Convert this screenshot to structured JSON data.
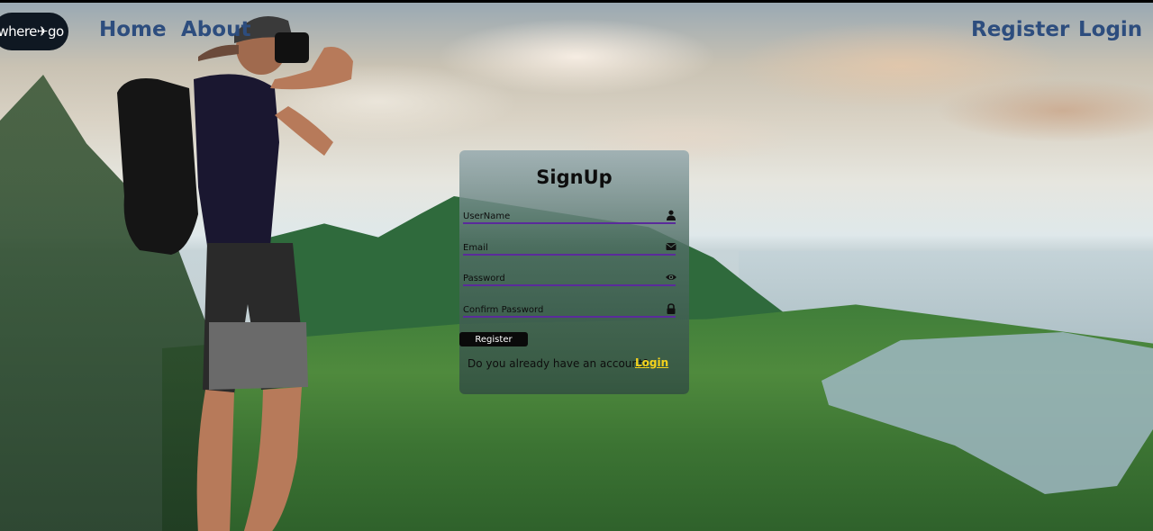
{
  "nav": {
    "logo_text": "where✈go",
    "home": "Home",
    "about": "About",
    "register": "Register",
    "login": "Login"
  },
  "signup": {
    "title": "SignUp",
    "fields": [
      {
        "placeholder": "UserName",
        "icon": "user-icon"
      },
      {
        "placeholder": "Email",
        "icon": "envelope-icon"
      },
      {
        "placeholder": "Password",
        "icon": "eye-icon"
      },
      {
        "placeholder": "Confirm Password",
        "icon": "lock-icon"
      }
    ],
    "register_button": "Register",
    "have_account": "Do you already have an account?",
    "login_link": "Login"
  },
  "colors": {
    "nav_link": "#2d4d7e",
    "field_underline": "#5a2b9b",
    "login_link": "#f5d31c",
    "logo_bg": "#0f1822"
  }
}
